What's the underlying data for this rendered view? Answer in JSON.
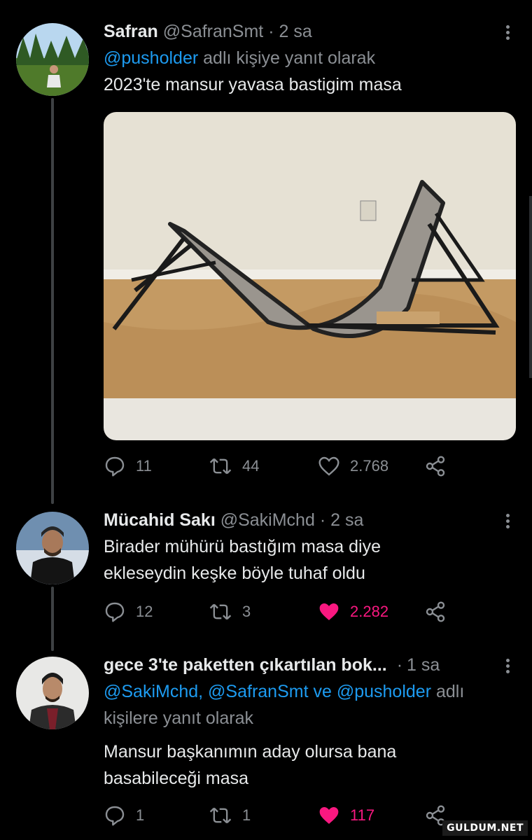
{
  "tweets": [
    {
      "name": "Safran",
      "handle": "@SafranSmt",
      "separator": "·",
      "time": "2 sa",
      "reply_mentions": [
        "@pusholder"
      ],
      "reply_suffix": "adlı kişiye yanıt olarak",
      "text": "2023'te mansur yavasa bastigim masa",
      "replies": "11",
      "retweets": "44",
      "likes": "2.768",
      "liked": false
    },
    {
      "name": "Mücahid Sakı",
      "handle": "@SakiMchd",
      "separator": "·",
      "time": "2 sa",
      "text_lines": [
        "Birader mühürü bastığım masa diye",
        "ekleseydin keşke böyle tuhaf oldu"
      ],
      "replies": "12",
      "retweets": "3",
      "likes": "2.282",
      "liked": true
    },
    {
      "name": "gece 3'te paketten çıkartılan bok...",
      "separator": "·",
      "time": "1 sa",
      "reply_mentions": [
        "@SakiMchd,",
        "@SafranSmt",
        "ve",
        "@pusholder"
      ],
      "reply_suffix": "adlı",
      "reply_line2": "kişilere yanıt olarak",
      "text_lines": [
        "Mansur başkanımın aday olursa bana",
        "basabileceği masa"
      ],
      "replies": "1",
      "retweets": "1",
      "likes": "117",
      "liked": true
    }
  ],
  "watermark": "GULDUM.NET",
  "colors": {
    "background": "#000000",
    "link": "#1d9bf0",
    "muted": "#8b8f94",
    "like": "#f91880",
    "text": "#e7e9ea"
  },
  "icons": [
    "reply-icon",
    "retweet-icon",
    "like-icon",
    "share-icon",
    "more-icon"
  ]
}
